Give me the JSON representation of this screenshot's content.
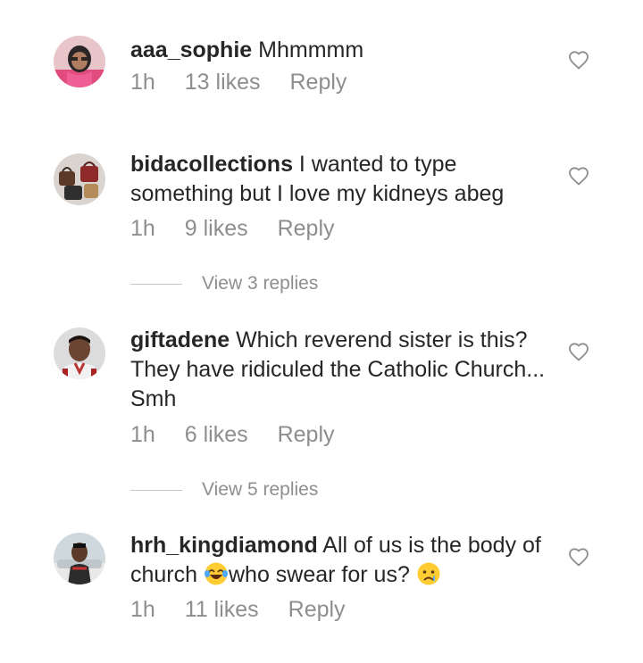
{
  "comments": [
    {
      "username": "aaa_sophie",
      "text": " Mhmmmm",
      "time": "1h",
      "likes": "13 likes",
      "reply": "Reply",
      "avatar_icon": "user-avatar"
    },
    {
      "username": "bidacollections",
      "text": " I wanted to type something but I love my kidneys abeg",
      "time": "1h",
      "likes": "9 likes",
      "reply": "Reply",
      "view_replies": "View 3 replies",
      "avatar_icon": "user-avatar"
    },
    {
      "username": "giftadene",
      "text": " Which reverend sister is this? They have ridiculed the Catholic Church... Smh",
      "time": "1h",
      "likes": "6 likes",
      "reply": "Reply",
      "view_replies": "View 5 replies",
      "avatar_icon": "user-avatar"
    },
    {
      "username": "hrh_kingdiamond",
      "text_part1": " All of us is the body of church ",
      "text_part2": "who swear for us? ",
      "time": "1h",
      "likes": "11 likes",
      "reply": "Reply",
      "avatar_icon": "user-avatar",
      "emojis": [
        "laughing-crying-emoji",
        "crying-emoji"
      ]
    }
  ],
  "icons": {
    "like": "heart-outline-icon"
  },
  "colors": {
    "text": "#262626",
    "meta": "#8e8e8e",
    "divider": "#c7c7c7"
  }
}
